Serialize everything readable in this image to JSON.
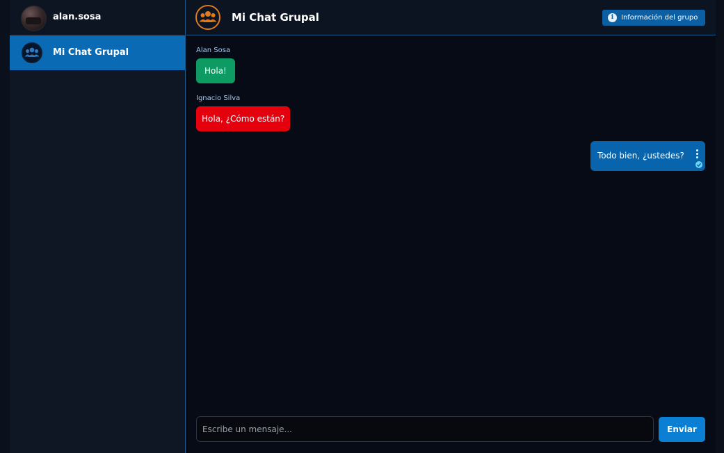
{
  "user": {
    "name": "alan.sosa",
    "avatar": "user-photo"
  },
  "sidebar": {
    "chats": [
      {
        "name": "Mi Chat Grupal",
        "icon": "group-icon",
        "active": true
      }
    ]
  },
  "header": {
    "title": "Mi Chat Grupal",
    "icon": "group-icon",
    "info_button": "Información del grupo",
    "info_icon": "info-icon"
  },
  "messages": [
    {
      "sender": "Alan Sosa",
      "text": "Hola!",
      "color": "#0e9a63",
      "own": false
    },
    {
      "sender": "Ignacio Silva",
      "text": "Hola, ¿Cómo están?",
      "color": "#e5000e",
      "own": false
    },
    {
      "sender": "",
      "text": "Todo bien, ¿ustedes?",
      "color": "#0865ad",
      "own": true,
      "status": "read-check-icon"
    }
  ],
  "composer": {
    "placeholder": "Escribe un mensaje...",
    "value": "",
    "send_label": "Enviar"
  },
  "colors": {
    "accent": "#0a6bb4",
    "group_avatar_ring": "#e07a1e"
  }
}
